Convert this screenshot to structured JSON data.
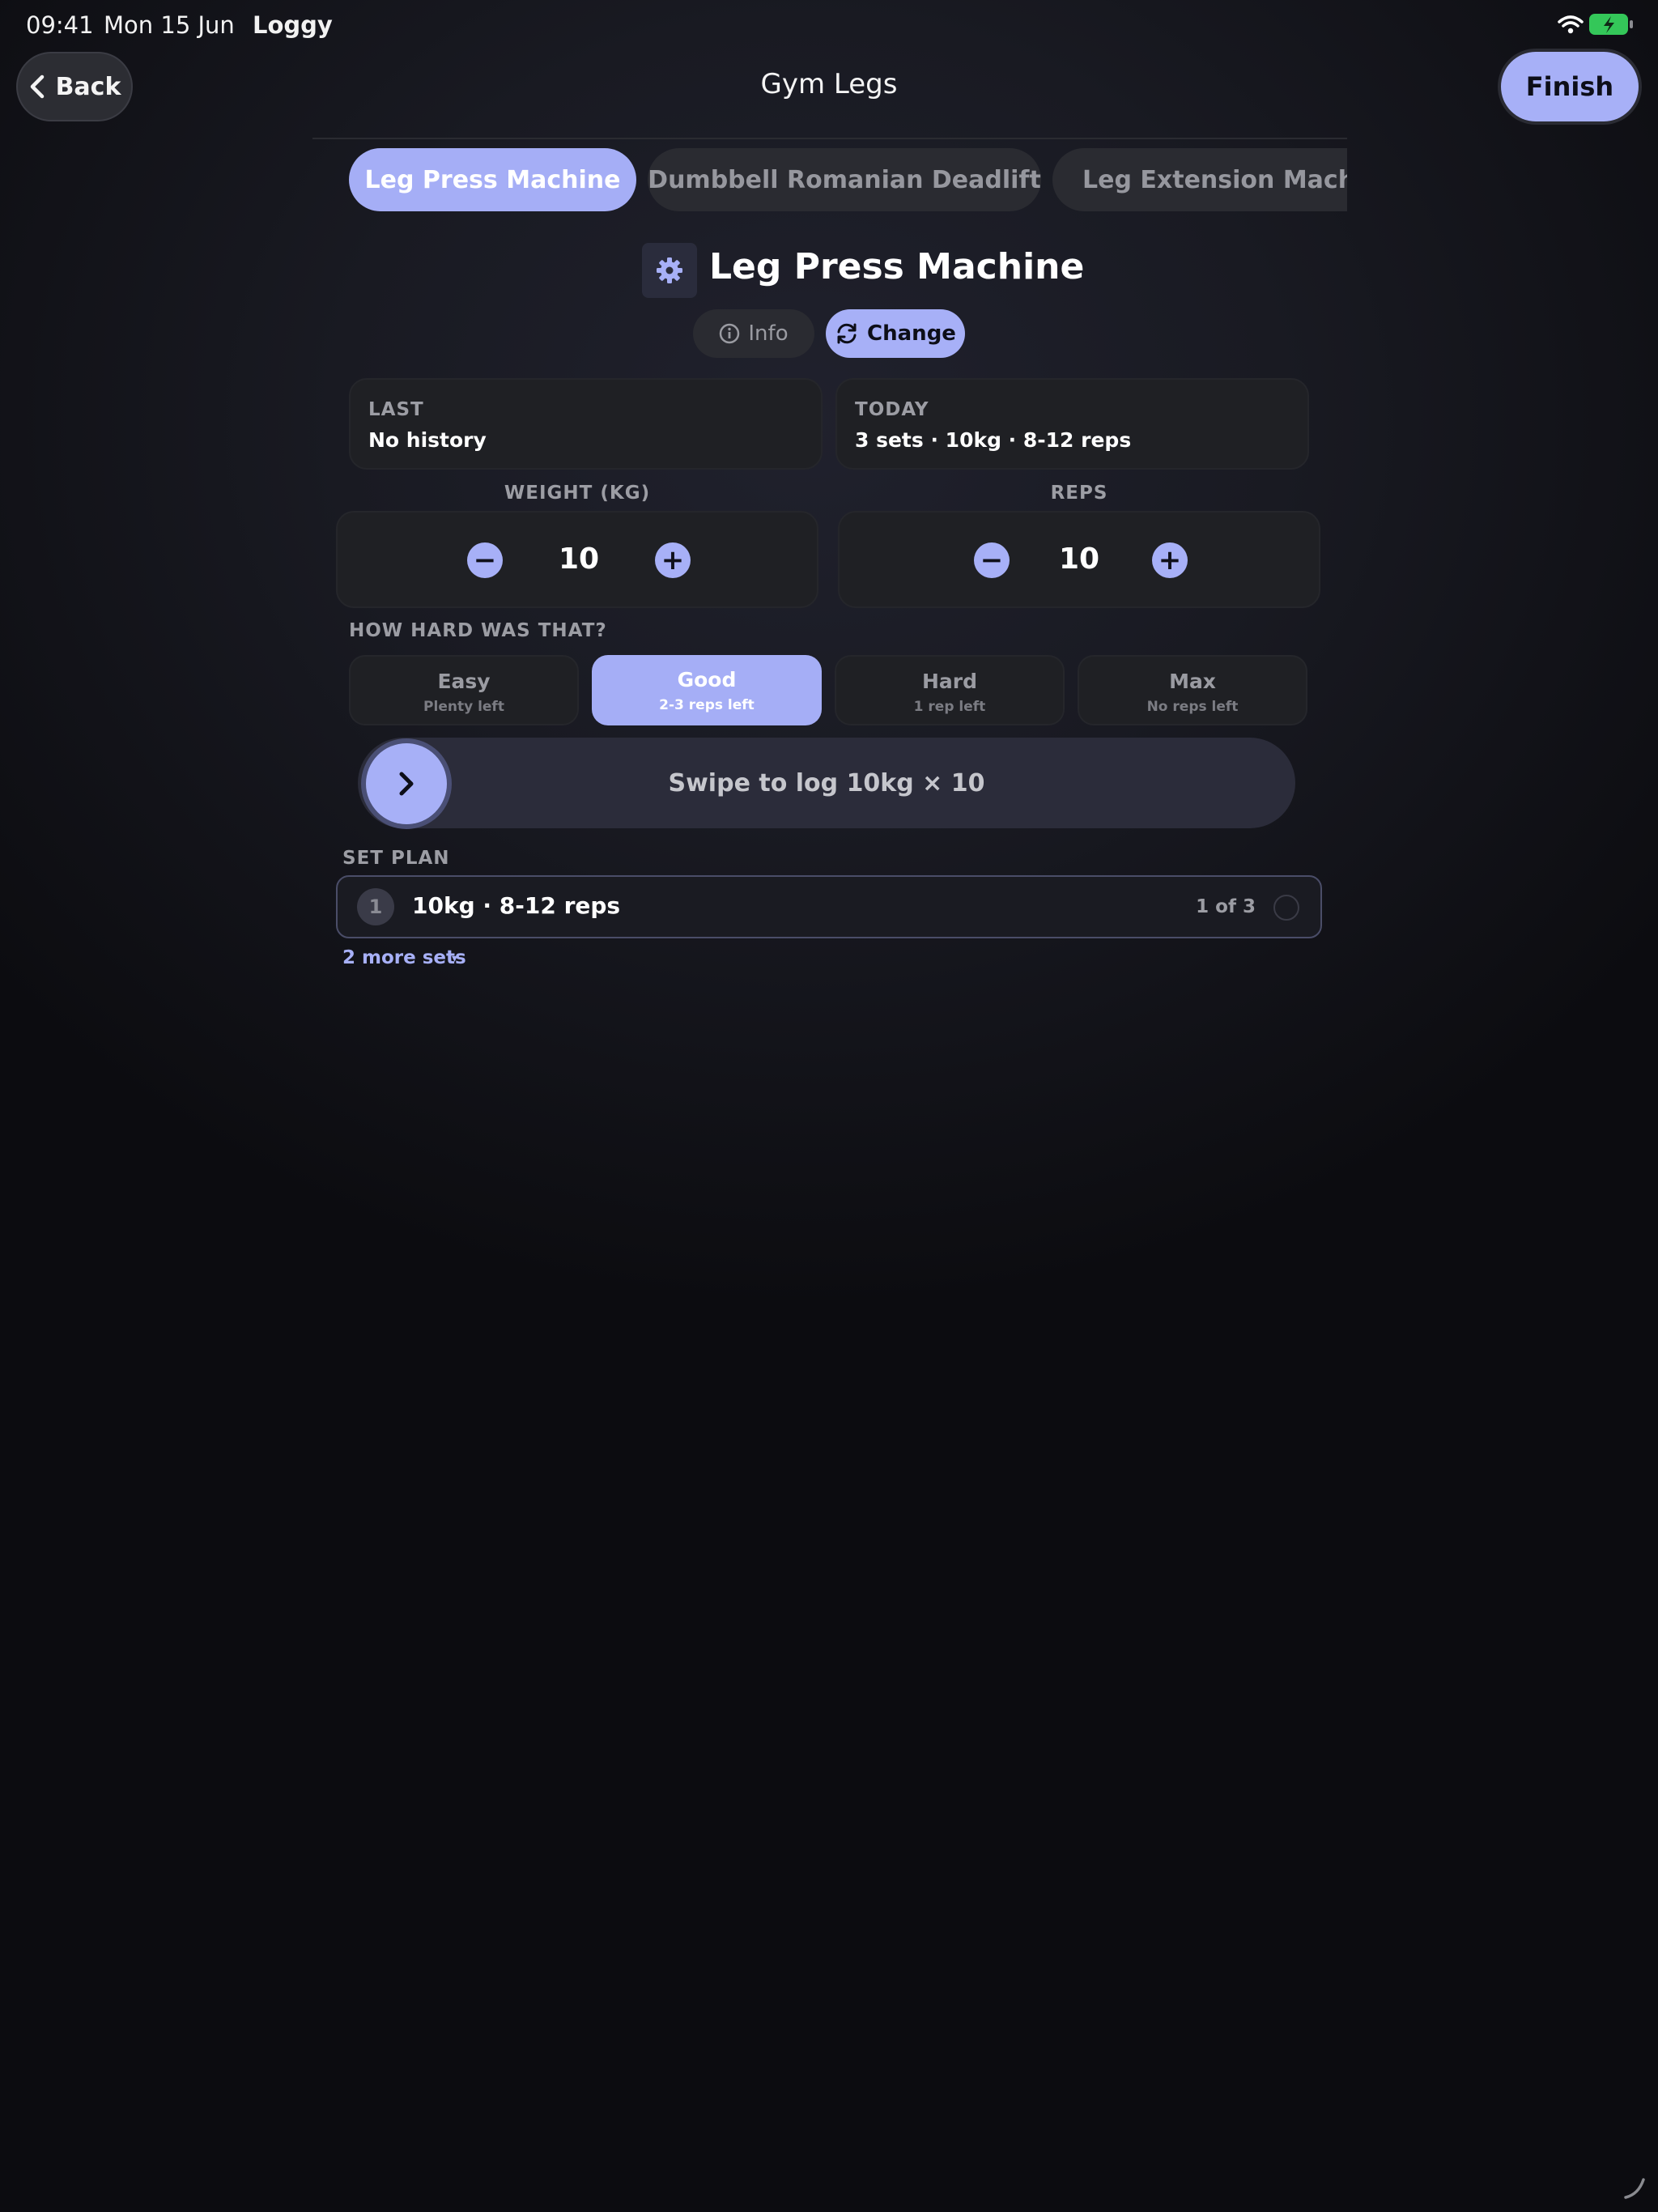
{
  "status_bar": {
    "time": "09:41",
    "date": "Mon 15 Jun",
    "app": "Loggy"
  },
  "nav": {
    "back_label": "Back",
    "title": "Gym Legs",
    "finish_label": "Finish"
  },
  "exercise_tabs": [
    {
      "label": "Leg Press Machine",
      "active": true
    },
    {
      "label": "Dumbbell Romanian Deadlift",
      "active": false
    },
    {
      "label": "Leg Extension Machine",
      "active": false
    }
  ],
  "exercise": {
    "title": "Leg Press Machine",
    "info_label": "Info",
    "change_label": "Change"
  },
  "summary": {
    "last": {
      "label": "LAST",
      "value": "No history"
    },
    "today": {
      "label": "TODAY",
      "value": "3 sets · 10kg · 8-12 reps"
    }
  },
  "weight": {
    "label": "WEIGHT (KG)",
    "value": "10",
    "minus": "−",
    "plus": "+"
  },
  "reps": {
    "label": "REPS",
    "value": "10",
    "minus": "−",
    "plus": "+"
  },
  "difficulty": {
    "label": "HOW HARD WAS THAT?",
    "options": [
      {
        "title": "Easy",
        "sub": "Plenty left",
        "selected": false
      },
      {
        "title": "Good",
        "sub": "2-3 reps left",
        "selected": true
      },
      {
        "title": "Hard",
        "sub": "1 rep left",
        "selected": false
      },
      {
        "title": "Max",
        "sub": "No reps left",
        "selected": false
      }
    ]
  },
  "swipe": {
    "label": "Swipe to log 10kg × 10"
  },
  "set_plan": {
    "label": "SET PLAN",
    "rows": [
      {
        "number": "1",
        "detail": "10kg · 8-12 reps",
        "progress": "1 of 3"
      }
    ],
    "more_label": "2 more sets",
    "more_caret": "▾"
  },
  "colors": {
    "accent": "#a7b0f7",
    "background": "#16171d",
    "card": "#1f2024"
  },
  "icons": [
    "chevron-left-icon",
    "gear-icon",
    "info-icon",
    "refresh-icon",
    "chevron-right-icon",
    "wifi-icon",
    "battery-icon"
  ]
}
